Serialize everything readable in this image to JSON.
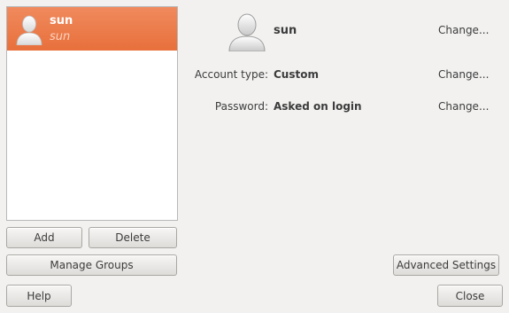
{
  "user_list": {
    "selected_user": {
      "name": "sun",
      "subtitle": "sun"
    }
  },
  "list_buttons": {
    "add": "Add",
    "delete": "Delete",
    "manage_groups": "Manage Groups"
  },
  "details": {
    "username": "sun",
    "account_type_label": "Account type:",
    "account_type_value": "Custom",
    "password_label": "Password:",
    "password_value": "Asked on login",
    "change_label": "Change..."
  },
  "footer": {
    "advanced_settings": "Advanced Settings",
    "help": "Help",
    "close": "Close"
  },
  "icons": {
    "avatar": "user-avatar-icon"
  },
  "colors": {
    "selection": "#e8703c",
    "window_bg": "#f2f1f0"
  }
}
